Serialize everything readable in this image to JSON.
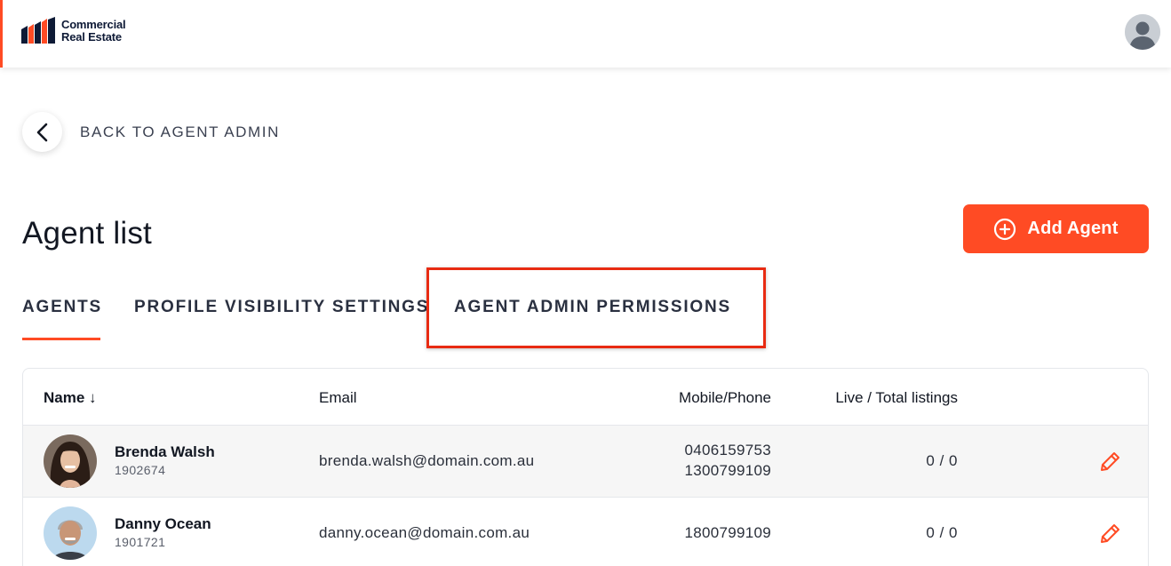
{
  "brand": {
    "line1": "Commercial",
    "line2": "Real Estate",
    "accent": "#ff4b24",
    "navy": "#0e1a36"
  },
  "header": {
    "avatar_icon": "user-avatar-icon"
  },
  "back": {
    "label": "BACK TO AGENT ADMIN",
    "icon": "chevron-left-icon"
  },
  "page": {
    "title": "Agent list"
  },
  "add_agent": {
    "label": "Add Agent",
    "icon": "plus-circle-icon"
  },
  "tabs": [
    {
      "label": "AGENTS",
      "active": true
    },
    {
      "label": "PROFILE VISIBILITY SETTINGS",
      "active": false
    },
    {
      "label": "AGENT ADMIN PERMISSIONS",
      "active": false,
      "highlighted": true
    }
  ],
  "table": {
    "columns": {
      "name": "Name ↓",
      "email": "Email",
      "phone": "Mobile/Phone",
      "listings": "Live / Total listings"
    },
    "rows": [
      {
        "name": "Brenda Walsh",
        "id": "1902674",
        "email": "brenda.walsh@domain.com.au",
        "phone1": "0406159753",
        "phone2": "1300799109",
        "listings": "0 / 0"
      },
      {
        "name": "Danny Ocean",
        "id": "1901721",
        "email": "danny.ocean@domain.com.au",
        "phone1": "1800799109",
        "phone2": "",
        "listings": "0 / 0"
      }
    ]
  }
}
